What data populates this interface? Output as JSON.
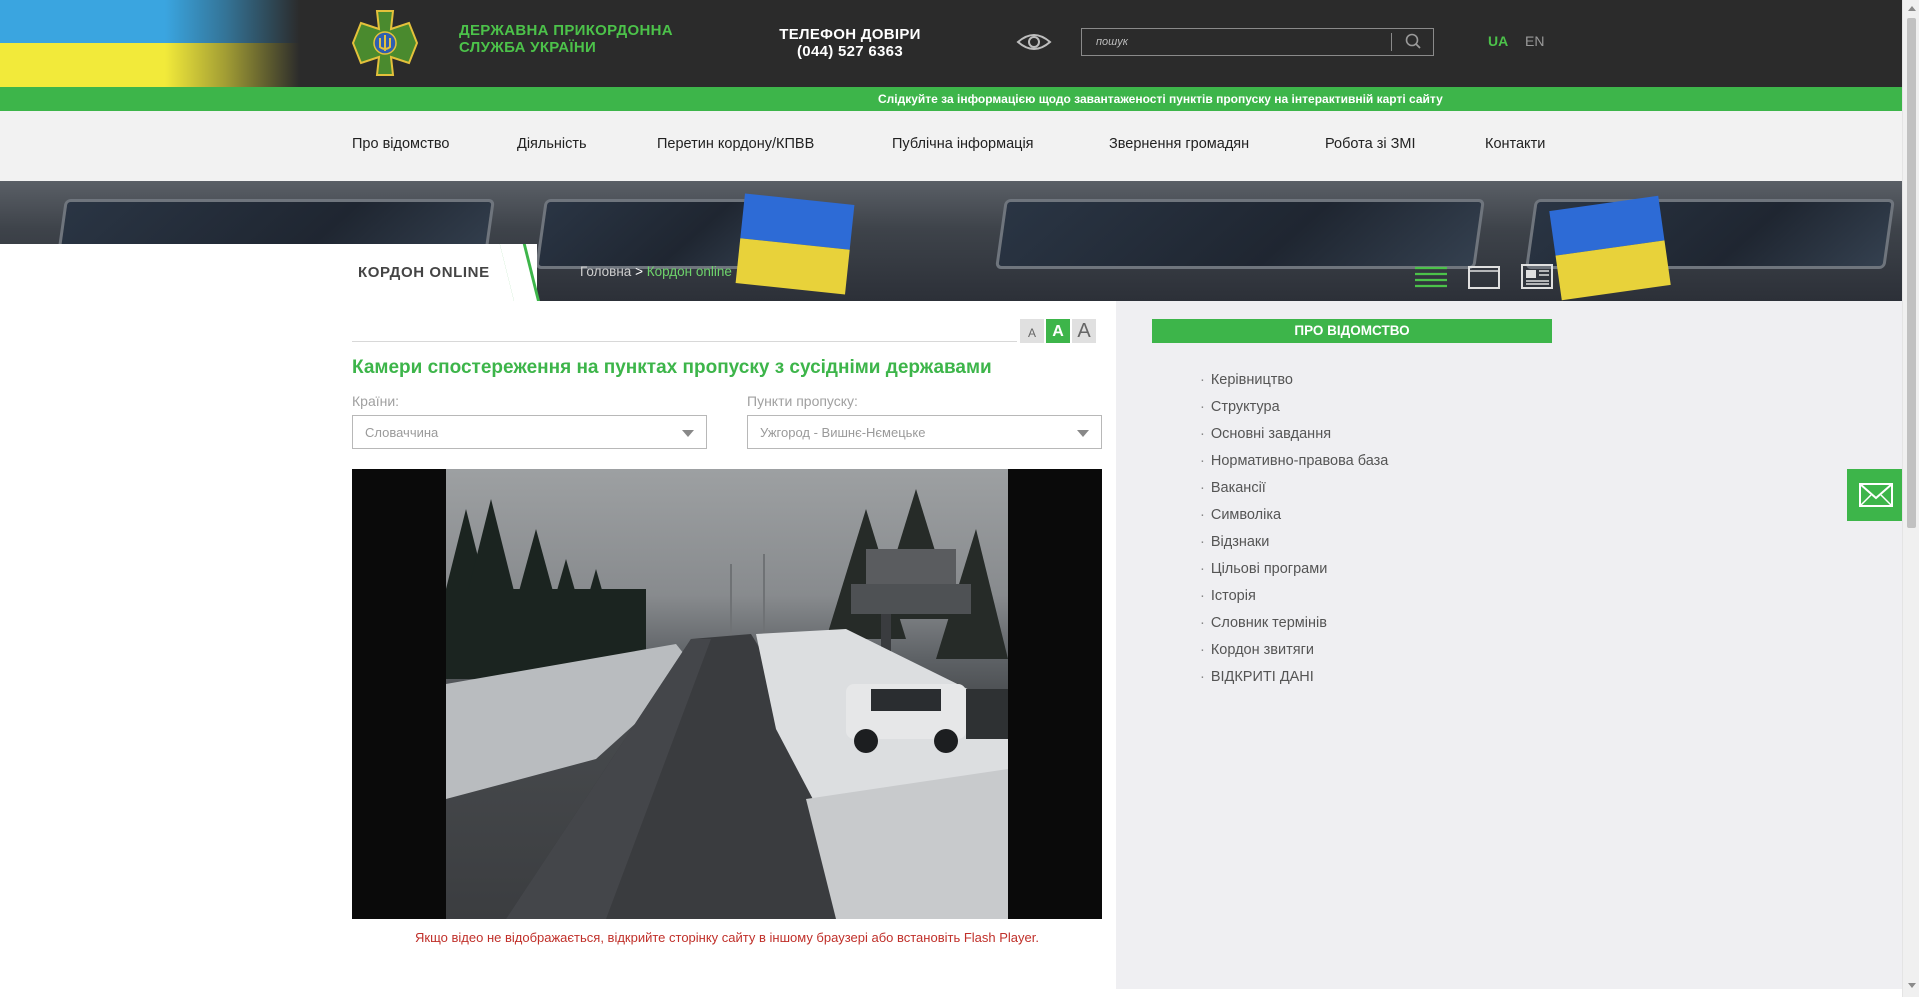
{
  "header": {
    "org_name_line1": "ДЕРЖАВНА ПРИКОРДОННА",
    "org_name_line2": "СЛУЖБА УКРАЇНИ",
    "hotline_title": "ТЕЛЕФОН ДОВІРИ",
    "hotline_number": "(044) 527 6363",
    "search_placeholder": "пошук",
    "lang_ua": "UA",
    "lang_en": "EN",
    "emblem_icon": "trident-cross-emblem",
    "accessibility_icon": "eye-icon"
  },
  "info_strip": {
    "text": "Слідкуйте за інформацією щодо завантаженості пунктів пропуску на інтерактивній карті сайту"
  },
  "nav": {
    "items": [
      "Про відомство",
      "Діяльність",
      "Перетин кордону/КПВВ",
      "Публічна інформація",
      "Звернення громадян",
      "Робота зі ЗМІ",
      "Контакти"
    ]
  },
  "section": {
    "title": "КОРДОН ONLINE",
    "breadcrumb_home": "Головна",
    "breadcrumb_sep": ">",
    "breadcrumb_current": "Кордон online"
  },
  "content": {
    "font_sizes": [
      "A",
      "A",
      "A"
    ],
    "page_title": "Камери спостереження на пунктах пропуску з сусідніми державами",
    "countries_label": "Країни:",
    "countries_value": "Словаччина",
    "checkpoints_label": "Пункти пропуску:",
    "checkpoints_value": "Ужгород - Вишнє-Нємецьке",
    "video_warning": "Якщо відео не відображається, відкрийте сторінку сайту в іншому браузері або встановіть Flash Player."
  },
  "sidebar": {
    "title": "ПРО ВІДОМСТВО",
    "items": [
      "Керівництво",
      "Структура",
      "Основні завдання",
      "Нормативно-правова база",
      "Вакансії",
      "Символіка",
      "Відзнаки",
      "Цільові програми",
      "Історія",
      "Словник термінів",
      "Кордон звитяги",
      "ВІДКРИТІ ДАНІ"
    ]
  },
  "colors": {
    "accent_green": "#3db54a",
    "header_dark": "#2b2b2b",
    "warning_red": "#c0302a"
  }
}
